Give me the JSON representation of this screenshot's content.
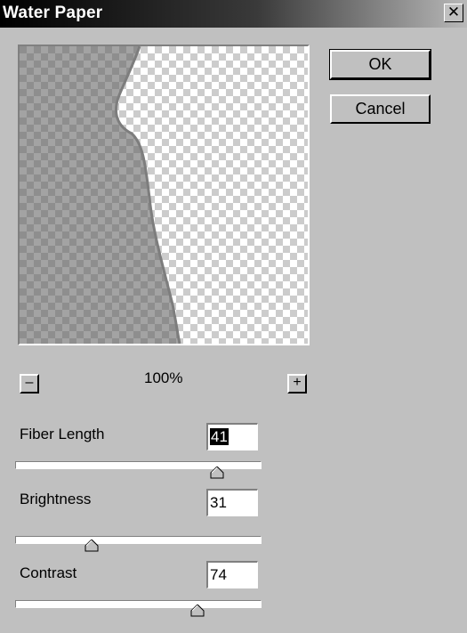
{
  "window": {
    "title": "Water Paper",
    "close_glyph": "✕"
  },
  "buttons": {
    "ok": "OK",
    "cancel": "Cancel"
  },
  "zoom": {
    "out": "–",
    "in": "+",
    "level": "100%"
  },
  "sliders": [
    {
      "label": "Fiber Length",
      "value": "41",
      "fraction": 0.82
    },
    {
      "label": "Brightness",
      "value": "31",
      "fraction": 0.31
    },
    {
      "label": "Contrast",
      "value": "74",
      "fraction": 0.74
    }
  ],
  "colors": {
    "dark_region": "#8c8c8c",
    "light_region": "#ffffff"
  }
}
